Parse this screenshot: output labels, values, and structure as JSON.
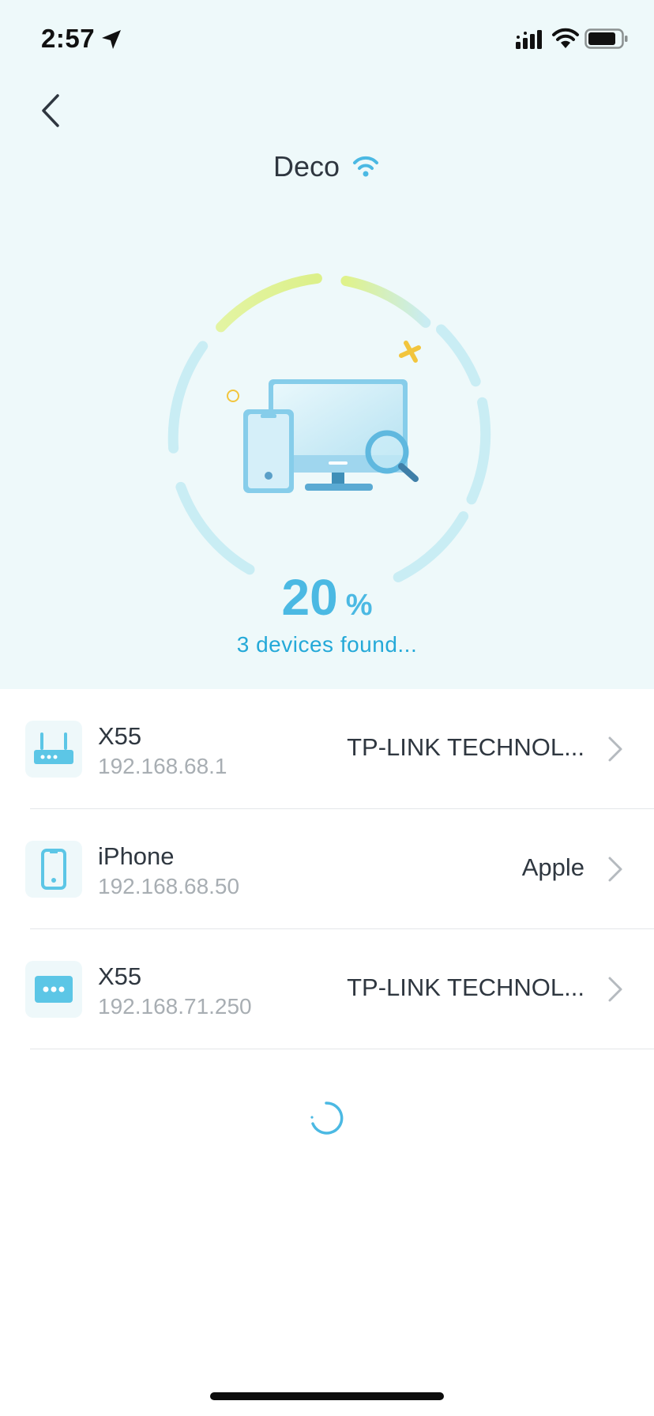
{
  "status_bar": {
    "time": "2:57",
    "icons": [
      "location-arrow-icon",
      "cellular-signal-icon",
      "wifi-icon",
      "battery-icon"
    ]
  },
  "header": {
    "back_icon": "chevron-left-icon",
    "title": "Deco",
    "title_icon": "wifi-icon"
  },
  "scan": {
    "progress_fraction": 0.2,
    "percent_value": "20",
    "percent_sign": "%",
    "status_text": "3 devices found...",
    "illustration_icon": "devices-search-illustration"
  },
  "devices": [
    {
      "icon": "router-icon",
      "name": "X55",
      "ip": "192.168.68.1",
      "vendor": "TP-LINK TECHNOL..."
    },
    {
      "icon": "phone-icon",
      "name": "iPhone",
      "ip": "192.168.68.50",
      "vendor": "Apple"
    },
    {
      "icon": "more-dots-icon",
      "name": "X55",
      "ip": "192.168.71.250",
      "vendor": "TP-LINK TECHNOL..."
    }
  ],
  "loading_icon": "loading-spinner-icon",
  "colors": {
    "accent": "#4bb9e3",
    "hero_background": "#eef9fa",
    "text_primary": "#2f3740",
    "text_secondary": "#a8aeb3",
    "ring_track": "#c6ecf3",
    "ring_progress": "#dff28b"
  }
}
